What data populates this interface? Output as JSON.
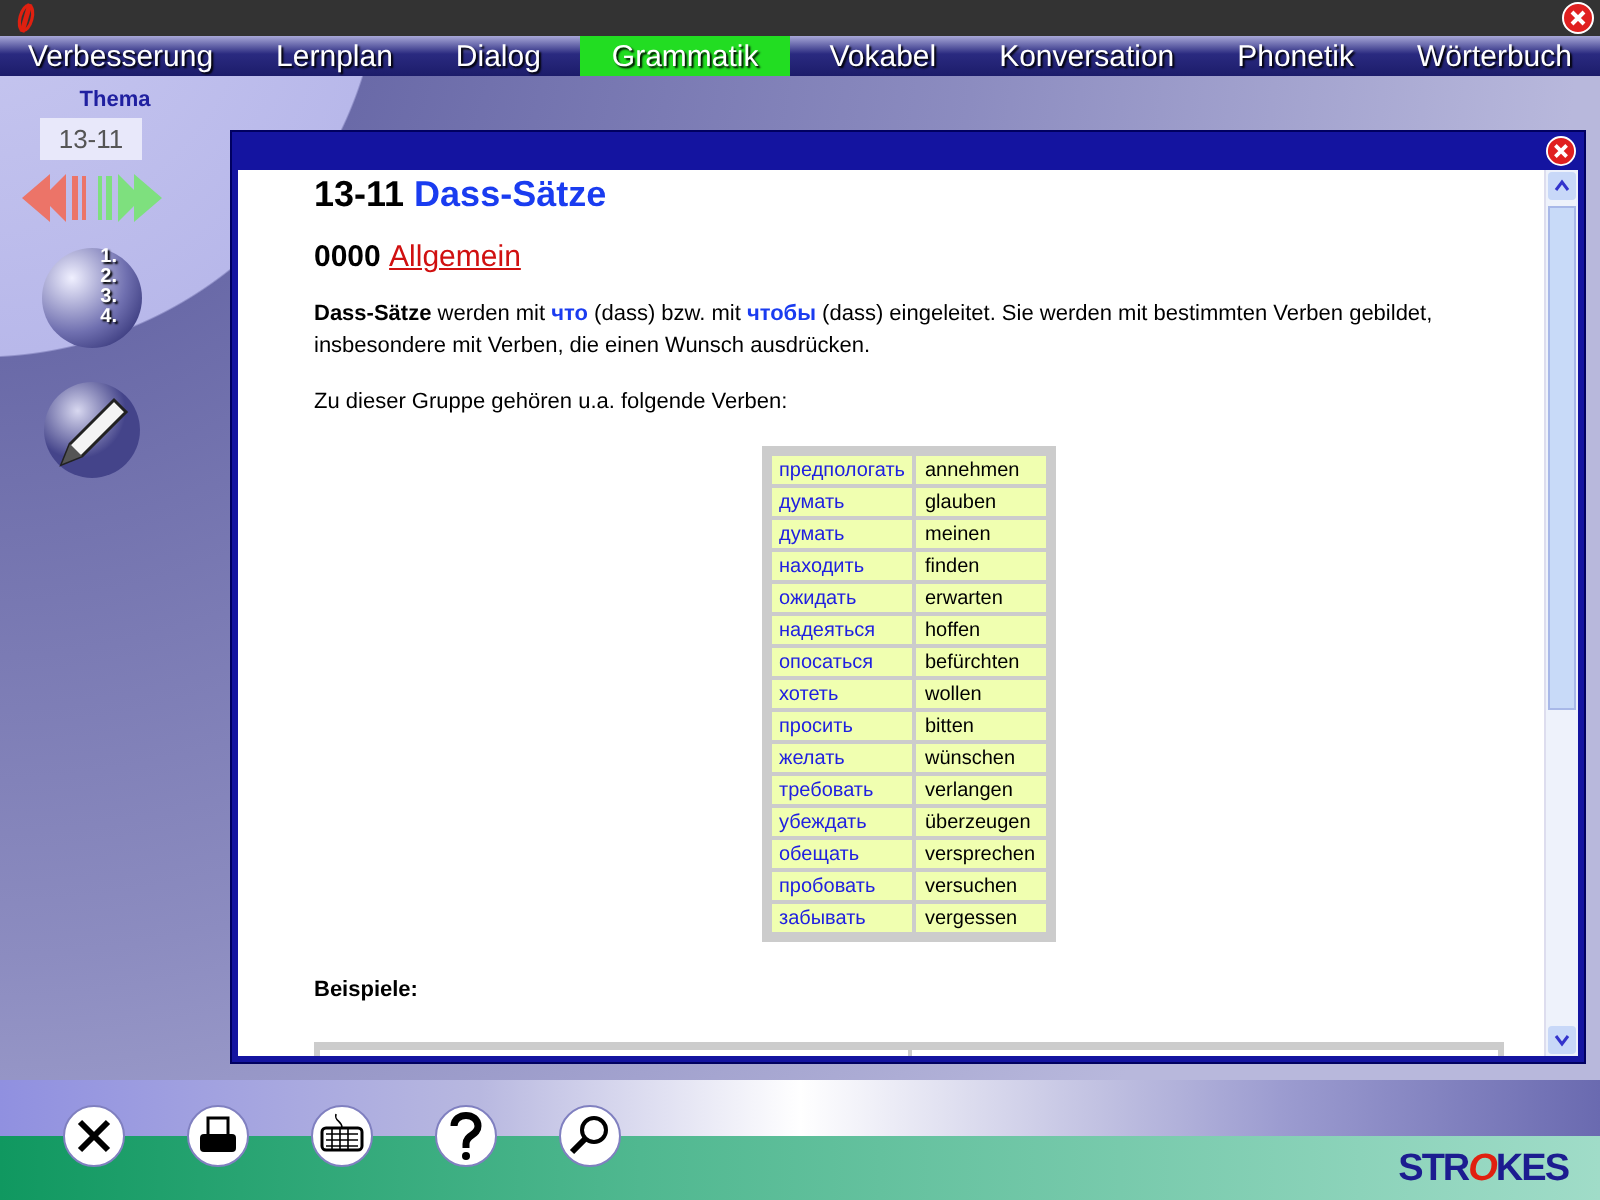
{
  "nav": [
    {
      "label": "Verbesserung",
      "selected": false
    },
    {
      "label": "Lernplan",
      "selected": false
    },
    {
      "label": "Dialog",
      "selected": false
    },
    {
      "label": "Grammatik",
      "selected": true
    },
    {
      "label": "Vokabel",
      "selected": false
    },
    {
      "label": "Konversation",
      "selected": false
    },
    {
      "label": "Phonetik",
      "selected": false
    },
    {
      "label": "Wörterbuch",
      "selected": false
    }
  ],
  "sidebar": {
    "label": "Thema",
    "topic": "13-11",
    "list_steps": [
      "1.",
      "2.",
      "3.",
      "4."
    ]
  },
  "article": {
    "number": "13-11",
    "title": "Dass-Sätze",
    "section_number": "0000",
    "section_link": "Allgemein",
    "intro": [
      {
        "kind": "term",
        "text": "Dass-Sätze"
      },
      {
        "kind": "plain",
        "text": " werden mit "
      },
      {
        "kind": "ru",
        "text": "что"
      },
      {
        "kind": "plain",
        "text": " (dass) bzw. mit "
      },
      {
        "kind": "ru",
        "text": "чтобы"
      },
      {
        "kind": "plain",
        "text": " (dass) eingeleitet. Sie werden mit bestimmten Verben gebildet, insbesondere mit Verben, die einen Wunsch ausdrücken."
      }
    ],
    "list_intro": "Zu dieser Gruppe gehören u.a. folgende Verben:",
    "verbs": [
      [
        "предпологать",
        "annehmen"
      ],
      [
        "думать",
        "glauben"
      ],
      [
        "думать",
        "meinen"
      ],
      [
        "находить",
        "finden"
      ],
      [
        "ожидать",
        "erwarten"
      ],
      [
        "надеяться",
        "hoffen"
      ],
      [
        "опосаться",
        "befürchten"
      ],
      [
        "хотеть",
        "wollen"
      ],
      [
        "просить",
        "bitten"
      ],
      [
        "желать",
        "wünschen"
      ],
      [
        "требовать",
        "verlangen"
      ],
      [
        "убеждать",
        "überzeugen"
      ],
      [
        "обещать",
        "versprechen"
      ],
      [
        "пробовать",
        "versuchen"
      ],
      [
        "забывать",
        "vergessen"
      ]
    ],
    "examples_heading": "Beispiele:"
  },
  "logo": {
    "before": "STR",
    "accent": "O",
    "after": "KES"
  }
}
